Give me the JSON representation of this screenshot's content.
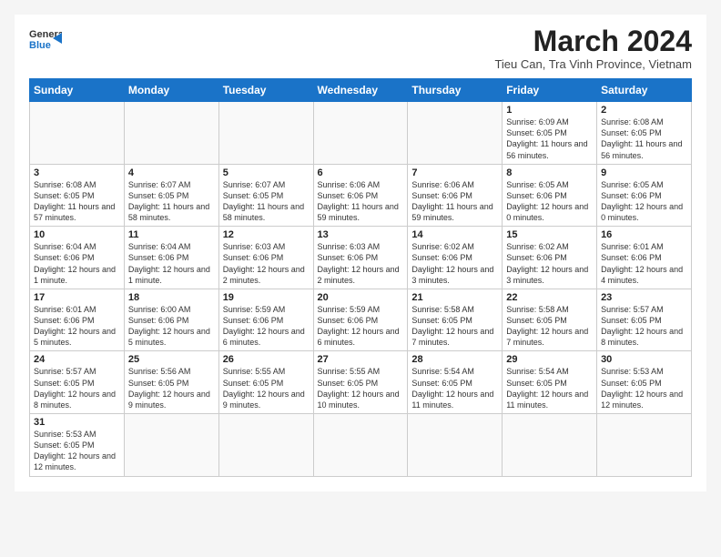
{
  "logo": {
    "line1": "General",
    "line2": "Blue"
  },
  "title": "March 2024",
  "subtitle": "Tieu Can, Tra Vinh Province, Vietnam",
  "weekdays": [
    "Sunday",
    "Monday",
    "Tuesday",
    "Wednesday",
    "Thursday",
    "Friday",
    "Saturday"
  ],
  "weeks": [
    [
      {
        "date": "",
        "info": ""
      },
      {
        "date": "",
        "info": ""
      },
      {
        "date": "",
        "info": ""
      },
      {
        "date": "",
        "info": ""
      },
      {
        "date": "",
        "info": ""
      },
      {
        "date": "1",
        "info": "Sunrise: 6:09 AM\nSunset: 6:05 PM\nDaylight: 11 hours and 56 minutes."
      },
      {
        "date": "2",
        "info": "Sunrise: 6:08 AM\nSunset: 6:05 PM\nDaylight: 11 hours and 56 minutes."
      }
    ],
    [
      {
        "date": "3",
        "info": "Sunrise: 6:08 AM\nSunset: 6:05 PM\nDaylight: 11 hours and 57 minutes."
      },
      {
        "date": "4",
        "info": "Sunrise: 6:07 AM\nSunset: 6:05 PM\nDaylight: 11 hours and 58 minutes."
      },
      {
        "date": "5",
        "info": "Sunrise: 6:07 AM\nSunset: 6:05 PM\nDaylight: 11 hours and 58 minutes."
      },
      {
        "date": "6",
        "info": "Sunrise: 6:06 AM\nSunset: 6:06 PM\nDaylight: 11 hours and 59 minutes."
      },
      {
        "date": "7",
        "info": "Sunrise: 6:06 AM\nSunset: 6:06 PM\nDaylight: 11 hours and 59 minutes."
      },
      {
        "date": "8",
        "info": "Sunrise: 6:05 AM\nSunset: 6:06 PM\nDaylight: 12 hours and 0 minutes."
      },
      {
        "date": "9",
        "info": "Sunrise: 6:05 AM\nSunset: 6:06 PM\nDaylight: 12 hours and 0 minutes."
      }
    ],
    [
      {
        "date": "10",
        "info": "Sunrise: 6:04 AM\nSunset: 6:06 PM\nDaylight: 12 hours and 1 minute."
      },
      {
        "date": "11",
        "info": "Sunrise: 6:04 AM\nSunset: 6:06 PM\nDaylight: 12 hours and 1 minute."
      },
      {
        "date": "12",
        "info": "Sunrise: 6:03 AM\nSunset: 6:06 PM\nDaylight: 12 hours and 2 minutes."
      },
      {
        "date": "13",
        "info": "Sunrise: 6:03 AM\nSunset: 6:06 PM\nDaylight: 12 hours and 2 minutes."
      },
      {
        "date": "14",
        "info": "Sunrise: 6:02 AM\nSunset: 6:06 PM\nDaylight: 12 hours and 3 minutes."
      },
      {
        "date": "15",
        "info": "Sunrise: 6:02 AM\nSunset: 6:06 PM\nDaylight: 12 hours and 3 minutes."
      },
      {
        "date": "16",
        "info": "Sunrise: 6:01 AM\nSunset: 6:06 PM\nDaylight: 12 hours and 4 minutes."
      }
    ],
    [
      {
        "date": "17",
        "info": "Sunrise: 6:01 AM\nSunset: 6:06 PM\nDaylight: 12 hours and 5 minutes."
      },
      {
        "date": "18",
        "info": "Sunrise: 6:00 AM\nSunset: 6:06 PM\nDaylight: 12 hours and 5 minutes."
      },
      {
        "date": "19",
        "info": "Sunrise: 5:59 AM\nSunset: 6:06 PM\nDaylight: 12 hours and 6 minutes."
      },
      {
        "date": "20",
        "info": "Sunrise: 5:59 AM\nSunset: 6:06 PM\nDaylight: 12 hours and 6 minutes."
      },
      {
        "date": "21",
        "info": "Sunrise: 5:58 AM\nSunset: 6:05 PM\nDaylight: 12 hours and 7 minutes."
      },
      {
        "date": "22",
        "info": "Sunrise: 5:58 AM\nSunset: 6:05 PM\nDaylight: 12 hours and 7 minutes."
      },
      {
        "date": "23",
        "info": "Sunrise: 5:57 AM\nSunset: 6:05 PM\nDaylight: 12 hours and 8 minutes."
      }
    ],
    [
      {
        "date": "24",
        "info": "Sunrise: 5:57 AM\nSunset: 6:05 PM\nDaylight: 12 hours and 8 minutes."
      },
      {
        "date": "25",
        "info": "Sunrise: 5:56 AM\nSunset: 6:05 PM\nDaylight: 12 hours and 9 minutes."
      },
      {
        "date": "26",
        "info": "Sunrise: 5:55 AM\nSunset: 6:05 PM\nDaylight: 12 hours and 9 minutes."
      },
      {
        "date": "27",
        "info": "Sunrise: 5:55 AM\nSunset: 6:05 PM\nDaylight: 12 hours and 10 minutes."
      },
      {
        "date": "28",
        "info": "Sunrise: 5:54 AM\nSunset: 6:05 PM\nDaylight: 12 hours and 11 minutes."
      },
      {
        "date": "29",
        "info": "Sunrise: 5:54 AM\nSunset: 6:05 PM\nDaylight: 12 hours and 11 minutes."
      },
      {
        "date": "30",
        "info": "Sunrise: 5:53 AM\nSunset: 6:05 PM\nDaylight: 12 hours and 12 minutes."
      }
    ],
    [
      {
        "date": "31",
        "info": "Sunrise: 5:53 AM\nSunset: 6:05 PM\nDaylight: 12 hours and 12 minutes."
      },
      {
        "date": "",
        "info": ""
      },
      {
        "date": "",
        "info": ""
      },
      {
        "date": "",
        "info": ""
      },
      {
        "date": "",
        "info": ""
      },
      {
        "date": "",
        "info": ""
      },
      {
        "date": "",
        "info": ""
      }
    ]
  ]
}
